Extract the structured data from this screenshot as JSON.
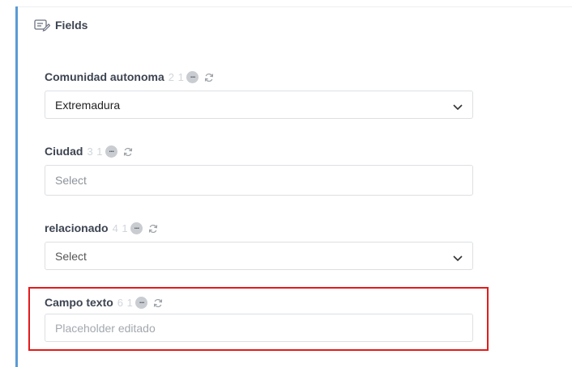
{
  "panel": {
    "title": "Fields",
    "title_icon": "edit-list-icon",
    "accent_color": "#5b9bd5"
  },
  "fields": [
    {
      "label": "Comunidad autonoma",
      "meta": "2 1",
      "control_type": "select",
      "value": "Extremadura",
      "placeholder": ""
    },
    {
      "label": "Ciudad",
      "meta": "3 1",
      "control_type": "select-empty",
      "value": "",
      "placeholder": "Select"
    },
    {
      "label": "relacionado",
      "meta": "4 1",
      "control_type": "select",
      "value": "",
      "placeholder": "Select"
    },
    {
      "label": "Campo texto",
      "meta": "6 1",
      "control_type": "text",
      "value": "",
      "placeholder": "Placeholder editado"
    }
  ],
  "highlight_color": "#e31b1b"
}
